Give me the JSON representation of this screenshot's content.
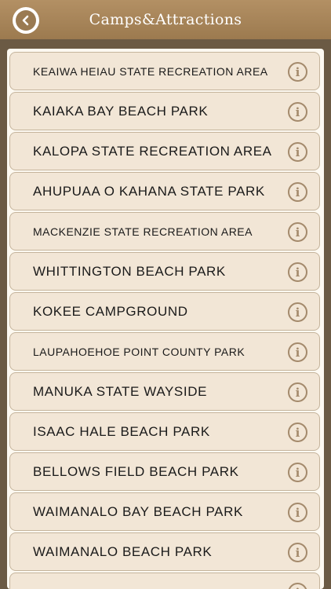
{
  "header": {
    "title": "Camps&Attractions",
    "back_icon": "back-arrow-icon",
    "color": "#a4845a"
  },
  "list": {
    "items": [
      {
        "label": "KEAIWA HEIAU STATE RECREATION AREA",
        "size": "small"
      },
      {
        "label": "KAIAKA BAY BEACH PARK",
        "size": "big"
      },
      {
        "label": "KALOPA STATE RECREATION AREA",
        "size": "big"
      },
      {
        "label": "AHUPUAA O KAHANA STATE PARK",
        "size": "big"
      },
      {
        "label": "MACKENZIE STATE RECREATION AREA",
        "size": "small"
      },
      {
        "label": "WHITTINGTON BEACH PARK",
        "size": "big"
      },
      {
        "label": "KOKEE CAMPGROUND",
        "size": "big"
      },
      {
        "label": "LAUPAHOEHOE POINT COUNTY PARK",
        "size": "small"
      },
      {
        "label": "MANUKA STATE WAYSIDE",
        "size": "big"
      },
      {
        "label": "ISAAC HALE BEACH PARK",
        "size": "big"
      },
      {
        "label": "BELLOWS FIELD BEACH PARK",
        "size": "big"
      },
      {
        "label": "WAIMANALO BAY BEACH PARK",
        "size": "big"
      },
      {
        "label": "WAIMANALO BEACH PARK",
        "size": "big"
      },
      {
        "label": "",
        "size": "big"
      }
    ],
    "info_icon": "info-icon",
    "info_glyph": "i"
  }
}
